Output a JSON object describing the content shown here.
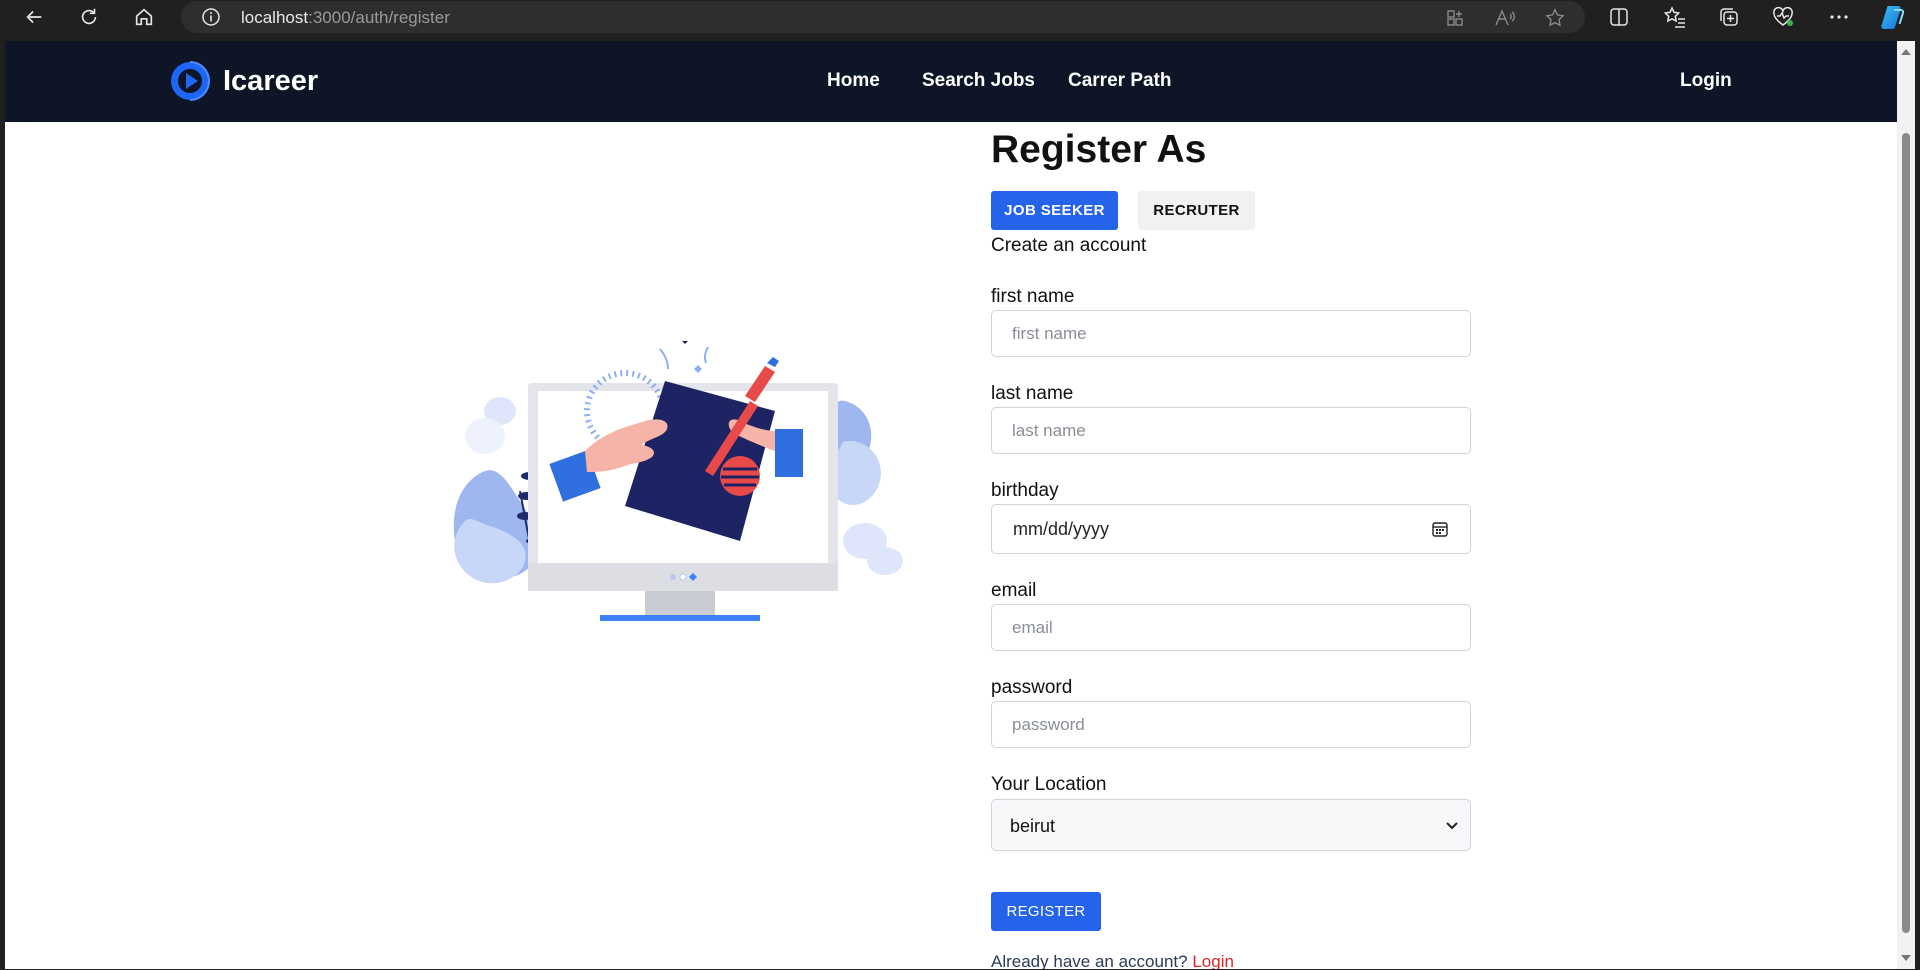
{
  "browser": {
    "url_host": "localhost",
    "url_path": ":3000/auth/register"
  },
  "nav": {
    "brand": "Icareer",
    "links": [
      "Home",
      "Search Jobs",
      "Carrer Path"
    ],
    "login": "Login"
  },
  "form": {
    "title": "Register As",
    "roles": [
      "JOB SEEKER",
      "RECRUTER"
    ],
    "selected_role": "JOB SEEKER",
    "subtitle": "Create an account",
    "fields": {
      "first_name": {
        "label": "first name",
        "placeholder": "first name"
      },
      "last_name": {
        "label": "last name",
        "placeholder": "last name"
      },
      "birthday": {
        "label": "birthday",
        "value": "mm/dd/yyyy"
      },
      "email": {
        "label": "email",
        "placeholder": "email"
      },
      "password": {
        "label": "password",
        "placeholder": "password"
      },
      "location": {
        "label": "Your Location",
        "value": "beirut"
      }
    },
    "submit": "REGISTER",
    "footer_text": "Already have an account?",
    "footer_link": "Login"
  },
  "colors": {
    "primary": "#2563eb",
    "navbar": "#0d1526",
    "link_red": "#dc2626"
  }
}
